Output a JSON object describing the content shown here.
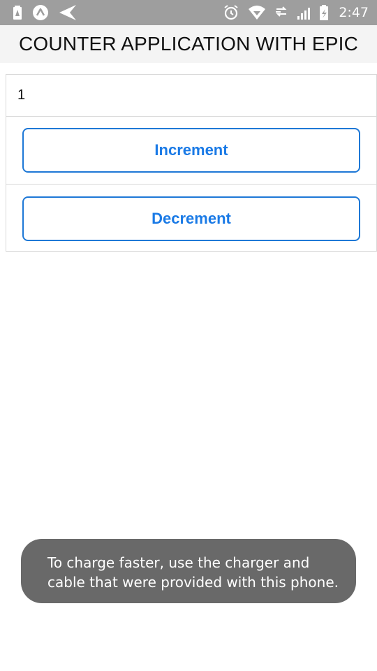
{
  "status_bar": {
    "left_icons": [
      "battery-alert-icon",
      "app-logo-icon",
      "send-icon"
    ],
    "right_icons": [
      "alarm-icon",
      "wifi-icon",
      "data-icon",
      "signal-icon",
      "battery-icon"
    ],
    "time": "2:47"
  },
  "header": {
    "title": "COUNTER APPLICATION WITH EPIC"
  },
  "counter": {
    "value": "1",
    "increment_label": "Increment",
    "decrement_label": "Decrement"
  },
  "toast": {
    "line1": "To charge faster, use the charger and",
    "line2": "cable that were provided with this phone."
  },
  "colors": {
    "accent": "#1a7ae6",
    "status_bar": "#9e9e9e",
    "header_bg": "#f4f4f4",
    "toast_bg": "#696969"
  }
}
